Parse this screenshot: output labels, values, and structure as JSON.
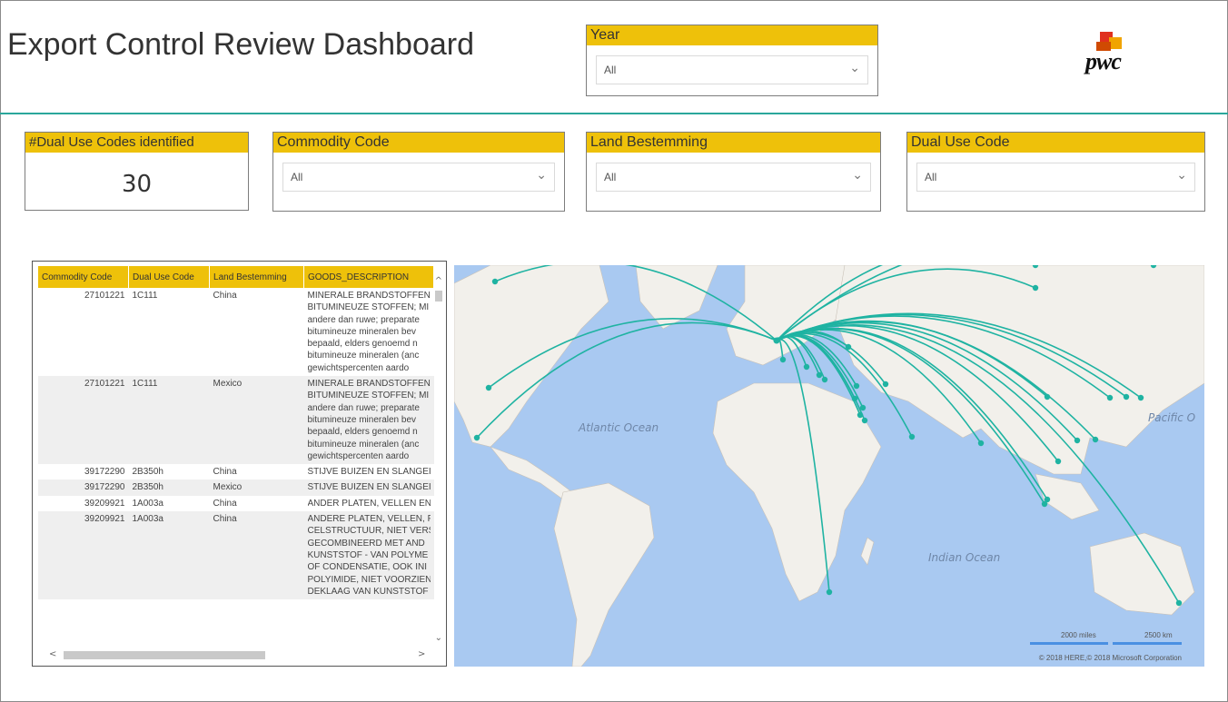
{
  "header": {
    "title": "Export Control Review Dashboard",
    "logo_text": "pwc"
  },
  "slicers": {
    "year": {
      "label": "Year",
      "value": "All"
    },
    "commodity": {
      "label": "Commodity Code",
      "value": "All"
    },
    "land": {
      "label": "Land Bestemming",
      "value": "All"
    },
    "dual_use": {
      "label": "Dual Use Code",
      "value": "All"
    }
  },
  "kpi": {
    "label": "#Dual Use Codes identified",
    "value": "30"
  },
  "table": {
    "columns": [
      "Commodity Code",
      "Dual Use Code",
      "Land Bestemming",
      "GOODS_DESCRIPTION"
    ],
    "rows": [
      {
        "commodity": "27101221",
        "dual": "1C111",
        "land": "China",
        "desc": [
          "MINERALE BRANDSTOFFEN",
          "BITUMINEUZE STOFFEN; MI",
          "andere dan ruwe; preparate",
          "bitumineuze mineralen bev",
          "bepaald, elders genoemd n",
          "bitumineuze mineralen (anc",
          "gewichtspercenten aardo"
        ]
      },
      {
        "commodity": "27101221",
        "dual": "1C111",
        "land": "Mexico",
        "desc": [
          "MINERALE BRANDSTOFFEN",
          "BITUMINEUZE STOFFEN; MI",
          "andere dan ruwe; preparate",
          "bitumineuze mineralen bev",
          "bepaald, elders genoemd n",
          "bitumineuze mineralen (anc",
          "gewichtspercenten aardo"
        ]
      },
      {
        "commodity": "39172290",
        "dual": "2B350h",
        "land": "China",
        "desc": [
          "STIJVE BUIZEN EN SLANGEI"
        ]
      },
      {
        "commodity": "39172290",
        "dual": "2B350h",
        "land": "Mexico",
        "desc": [
          "STIJVE BUIZEN EN SLANGEI"
        ]
      },
      {
        "commodity": "39209921",
        "dual": "1A003a",
        "land": "China",
        "desc": [
          "ANDER PLATEN, VELLEN EN"
        ]
      },
      {
        "commodity": "39209921",
        "dual": "1A003a",
        "land": "China",
        "desc": [
          "ANDERE PLATEN, VELLEN, F",
          "CELSTRUCTUUR, NIET VERS",
          "GECOMBINEERD MET AND",
          "KUNSTSTOF - VAN POLYME",
          "OF CONDENSATIE, OOK INI",
          "POLYIMIDE, NIET VOORZIEN",
          "DEKLAAG VAN KUNSTSTOF"
        ]
      }
    ]
  },
  "map": {
    "oceans": [
      "Atlantic Ocean",
      "Indian Ocean",
      "Pacific O"
    ],
    "scale_miles": "2000 miles",
    "scale_km": "2500 km",
    "credit": "© 2018 HERE,© 2018 Microsoft Corporation",
    "route_color": "#1fb3a2",
    "land_color": "#f2f0eb"
  }
}
